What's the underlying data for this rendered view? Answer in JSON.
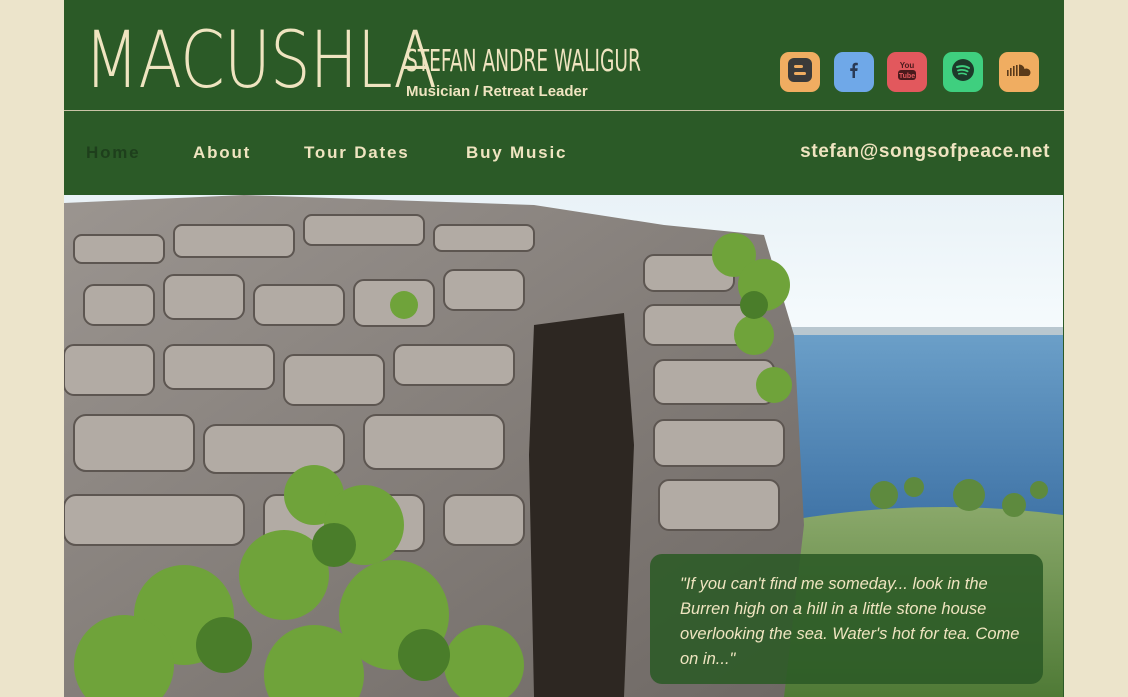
{
  "header": {
    "brand": "MACUSHLA",
    "artist_name": "STEFAN ANDRE WALIGUR",
    "tagline": "Musician / Retreat Leader"
  },
  "social": [
    {
      "name": "blogger",
      "icon": "blogger-icon",
      "color": "#f0ad61"
    },
    {
      "name": "facebook",
      "icon": "facebook-icon",
      "color": "#6fa8e8"
    },
    {
      "name": "youtube",
      "icon": "youtube-icon",
      "color": "#e2585d"
    },
    {
      "name": "spotify",
      "icon": "spotify-icon",
      "color": "#3fcf7f"
    },
    {
      "name": "soundcloud",
      "icon": "soundcloud-icon",
      "color": "#f0ad61"
    }
  ],
  "nav": {
    "items": [
      "Home",
      "About",
      "Tour Dates",
      "Buy Music"
    ],
    "active": "Home",
    "email": "stefan@songsofpeace.net"
  },
  "hero": {
    "quote": "\"If you can't find me someday... look in the Burren high on a hill in a little stone house overlooking the sea. Water's hot for tea. Come on in...\""
  },
  "colors": {
    "page_bg": "#ece4cb",
    "header_green": "#2b5a27",
    "cream_text": "#efe4c0",
    "active_nav": "#1e3f1c"
  }
}
